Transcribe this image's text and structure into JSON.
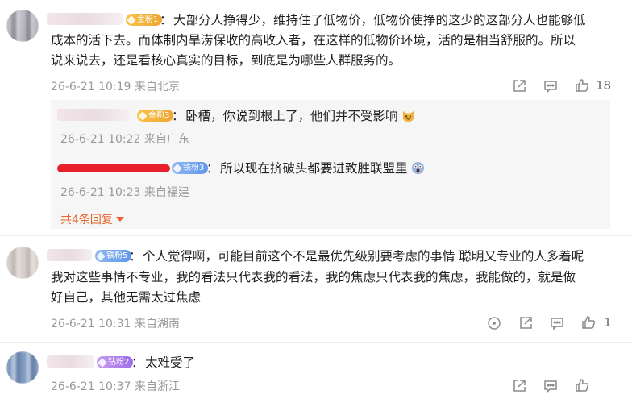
{
  "comments": [
    {
      "badge": "金粉1",
      "text_lines": [
        "大部分人挣得少，维持住了低物价，低物价使挣的这少的这部分人也能够低",
        "成本的活下去。而体制内旱涝保收的高收入者，在这样的低物价环境，活的是相当舒服的。所以",
        "说来说去，还是看核心真实的目标，到底是为哪些人群服务的。"
      ],
      "time": "26-6-21 10:19",
      "location": "来自北京",
      "likes": "18",
      "replies": [
        {
          "badge": "金粉3",
          "text": "卧槽，你说到根上了，他们并不受影响",
          "emoji": "cat-face-emoji",
          "time": "26-6-21 10:22",
          "location": "来自广东"
        },
        {
          "badge": "铁粉3",
          "text": "所以现在挤破头都要进致胜联盟里",
          "emoji": "scream-face-emoji",
          "time": "26-6-21 10:23",
          "location": "来自福建"
        }
      ],
      "more_replies": "共4条回复"
    },
    {
      "badge": "铁粉5",
      "text_lines": [
        "个人觉得啊，可能目前这个不是最优先级别要考虑的事情  聪明又专业的人多着呢",
        "我对这些事情不专业，我的看法只代表我的看法，我的焦虑只代表我的焦虑，我能做的，就是做",
        "好自己，其他无需太过焦虑"
      ],
      "time": "26-6-21 10:31",
      "location": "来自湖南",
      "likes": "1"
    },
    {
      "badge": "钻粉2",
      "text_lines": [
        "太难受了"
      ],
      "time": "26-6-21 10:37",
      "location": "来自浙江",
      "likes": ""
    }
  ],
  "colon": "：",
  "colors": {
    "accent": "#e8632b",
    "meta": "#9a9a9a",
    "redaction": "#e8202a"
  },
  "icons": [
    "share-icon",
    "comment-icon",
    "like-icon",
    "dislike-icon"
  ]
}
